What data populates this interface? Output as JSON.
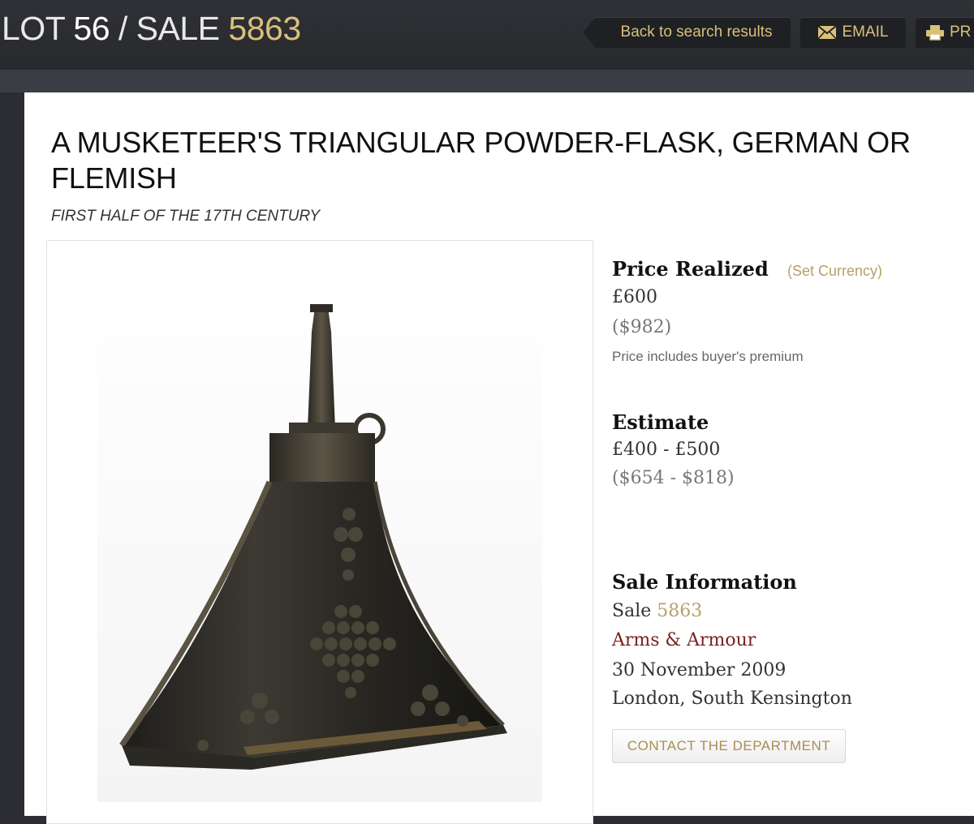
{
  "header": {
    "lot_prefix": "LOT ",
    "lot_number": "56",
    "separator": " / SALE ",
    "sale_number": "5863",
    "back_label": "Back to search results",
    "email_label": "EMAIL",
    "print_label": "PR"
  },
  "item": {
    "title": "A MUSKETEER'S TRIANGULAR POWDER-FLASK, GERMAN OR FLEMISH",
    "subtitle": "FIRST HALF OF THE 17TH CENTURY"
  },
  "price": {
    "label": "Price Realized",
    "set_currency": "(Set Currency)",
    "gbp": "£600",
    "usd": "($982)",
    "note": "Price includes buyer's premium"
  },
  "estimate": {
    "label": "Estimate",
    "gbp": "£400 - £500",
    "usd": "($654 - $818)"
  },
  "sale_info": {
    "label": "Sale Information",
    "sale_prefix": "Sale ",
    "sale_number": "5863",
    "department": "Arms & Armour",
    "date": "30 November 2009",
    "location": "London, South Kensington"
  },
  "contact_button": "CONTACT THE DEPARTMENT",
  "colors": {
    "accent_gold": "#d9c07a",
    "link_gold": "#b7a06a",
    "department_red": "#7a1f1f",
    "header_bg": "#2b2d32"
  },
  "icons": {
    "email": "envelope-icon",
    "print": "printer-icon",
    "back": "left-arrow-tab"
  }
}
